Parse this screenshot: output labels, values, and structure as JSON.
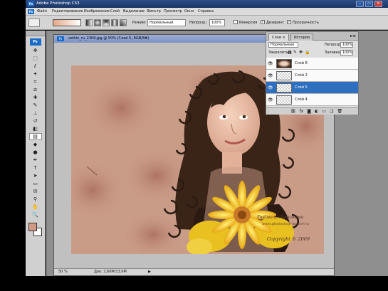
{
  "window": {
    "title": "Adobe Photoshop CS3",
    "badge": "Ps",
    "controls": [
      "‒",
      "▭",
      "✕"
    ]
  },
  "menu": [
    "Файл",
    "Редактирование",
    "Изображение",
    "Слой",
    "Выделение",
    "Фильтр",
    "Просмотр",
    "Окно",
    "Справка"
  ],
  "options": {
    "mode_label": "Режим:",
    "mode_value": "Нормальный",
    "opacity_label": "Непрозр.:",
    "opacity_value": "100%",
    "invert_label": "Инверсия",
    "dither_label": "Дизеринг",
    "transparency_label": "Прозрачность"
  },
  "toolbox": {
    "logo": "Ps",
    "tools": [
      {
        "name": "move-tool-icon",
        "glyph": "✥"
      },
      {
        "name": "marquee-tool-icon",
        "glyph": "⬚"
      },
      {
        "name": "lasso-tool-icon",
        "glyph": "ℓ"
      },
      {
        "name": "magic-wand-tool-icon",
        "glyph": "✦"
      },
      {
        "name": "crop-tool-icon",
        "glyph": "⌗"
      },
      {
        "name": "slice-tool-icon",
        "glyph": "⧄"
      },
      {
        "name": "healing-brush-tool-icon",
        "glyph": "✚"
      },
      {
        "name": "brush-tool-icon",
        "glyph": "✎"
      },
      {
        "name": "clone-stamp-tool-icon",
        "glyph": "⊥"
      },
      {
        "name": "history-brush-tool-icon",
        "glyph": "↺"
      },
      {
        "name": "eraser-tool-icon",
        "glyph": "◧"
      },
      {
        "name": "gradient-tool-icon",
        "glyph": "▤",
        "active": true
      },
      {
        "name": "blur-tool-icon",
        "glyph": "◆"
      },
      {
        "name": "dodge-tool-icon",
        "glyph": "●"
      },
      {
        "name": "pen-tool-icon",
        "glyph": "✒"
      },
      {
        "name": "type-tool-icon",
        "glyph": "T"
      },
      {
        "name": "path-selection-tool-icon",
        "glyph": "➤"
      },
      {
        "name": "shape-tool-icon",
        "glyph": "▭"
      },
      {
        "name": "notes-tool-icon",
        "glyph": "✉"
      },
      {
        "name": "eyedropper-tool-icon",
        "glyph": "⚲"
      },
      {
        "name": "hand-tool-icon",
        "glyph": "✋"
      },
      {
        "name": "zoom-tool-icon",
        "glyph": "🔍"
      }
    ]
  },
  "document": {
    "title": "vetkin_ru_2309.jpg @ 50% (Слой 5, RGB/8#)",
    "zoom": "50 %",
    "doc_size": "Док: 2,60М/13,6М",
    "watermark_line1": "Людмила Лукьянова",
    "watermark_line2": "www.photoshop-master.ru",
    "copyright": "Copyright © 2009"
  },
  "layers_panel": {
    "tabs": [
      "Слои ×",
      "История"
    ],
    "blend_mode": "Нормальные",
    "opacity_label": "Непрозр.:",
    "opacity_value": "100%",
    "lock_label": "Закрепить:",
    "fill_label": "Заливка:",
    "fill_value": "100%",
    "layers": [
      {
        "name": "Слой 8",
        "selected": false
      },
      {
        "name": "Слой 2",
        "selected": false
      },
      {
        "name": "Слой 5",
        "selected": true
      },
      {
        "name": "Слой 4",
        "selected": false
      }
    ],
    "footer_icons": [
      "link-icon",
      "fx-icon",
      "mask-icon",
      "adjustment-icon",
      "folder-icon",
      "new-layer-icon",
      "trash-icon"
    ]
  },
  "colors": {
    "foreground": "#d29984",
    "background": "#ffffff",
    "selection": "#2f6fc0"
  }
}
